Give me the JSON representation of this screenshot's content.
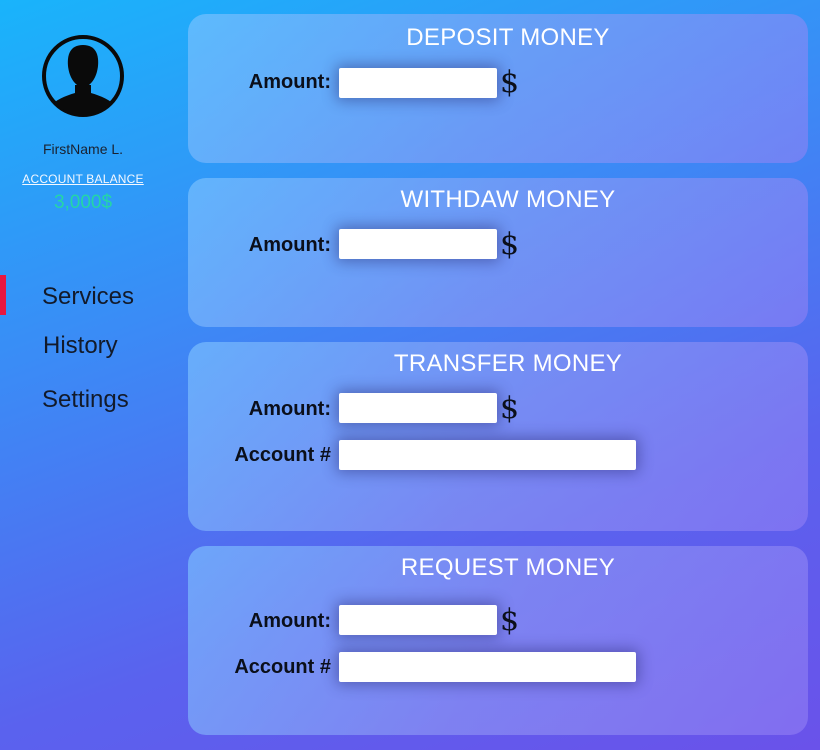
{
  "sidebar": {
    "user_name": "FirstName L.",
    "balance_label": "ACCOUNT BALANCE",
    "balance_value": "3,000$",
    "nav": {
      "services": "Services",
      "history": "History",
      "settings": "Settings"
    },
    "active_item": "Services"
  },
  "cards": {
    "deposit": {
      "title": "DEPOSIT MONEY",
      "amount_label": "Amount:",
      "amount_value": "",
      "currency": "$"
    },
    "withdraw": {
      "title": "WITHDAW MONEY",
      "amount_label": "Amount:",
      "amount_value": "",
      "currency": "$"
    },
    "transfer": {
      "title": "TRANSFER MONEY",
      "amount_label": "Amount:",
      "amount_value": "",
      "currency": "$",
      "account_label": "Account #",
      "account_value": ""
    },
    "request": {
      "title": "REQUEST MONEY",
      "amount_label": "Amount:",
      "amount_value": "",
      "currency": "$",
      "account_label": "Account #",
      "account_value": ""
    }
  },
  "colors": {
    "background_start": "#19b4fb",
    "background_end": "#6a52ea",
    "active_indicator": "#e8173f",
    "balance": "#24d6a6",
    "card_title": "#ffffff"
  },
  "icons": {
    "avatar": "user-avatar-icon",
    "currency": "dollar-icon"
  }
}
